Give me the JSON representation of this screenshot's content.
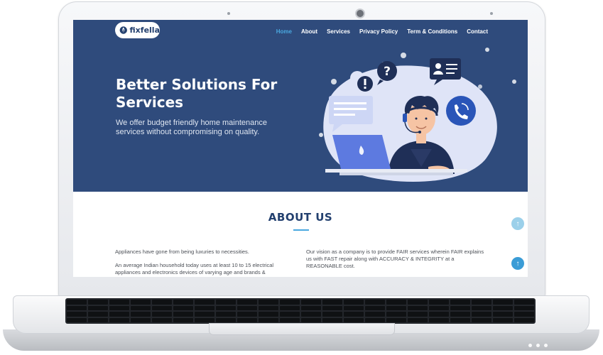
{
  "brand": {
    "name": "fixfella"
  },
  "nav": {
    "items": [
      {
        "label": "Home",
        "active": true
      },
      {
        "label": "About",
        "active": false
      },
      {
        "label": "Services",
        "active": false
      },
      {
        "label": "Privacy Policy",
        "active": false
      },
      {
        "label": "Term & Conditions",
        "active": false
      },
      {
        "label": "Contact",
        "active": false
      }
    ]
  },
  "hero": {
    "title": "Better Solutions For Services",
    "subtitle": "We offer budget friendly home maintenance services without compromising on quality."
  },
  "about": {
    "title": "ABOUT US",
    "left": [
      "Appliances have gone from being luxuries to necessities.",
      "An average Indian household today uses at least 10 to 15 electrical appliances and electronics devices of varying age and brands &"
    ],
    "right": [
      "Our vision as a company is to provide FAIR services wherein FAIR explains us with FAST repair along with ACCURACY & INTEGRITY at a REASONABLE cost."
    ]
  },
  "icons": {
    "scroll_top": "arrow-up-icon",
    "logo": "flame-wrench-icon",
    "question": "question-mark-icon",
    "alert": "exclamation-icon",
    "phone": "phone-icon",
    "contact_card": "contact-card-icon",
    "chat": "chat-bubble-icon"
  },
  "colors": {
    "nav_bg": "#2f4b7c",
    "accent": "#4aa8e0",
    "heading": "#23406f"
  }
}
